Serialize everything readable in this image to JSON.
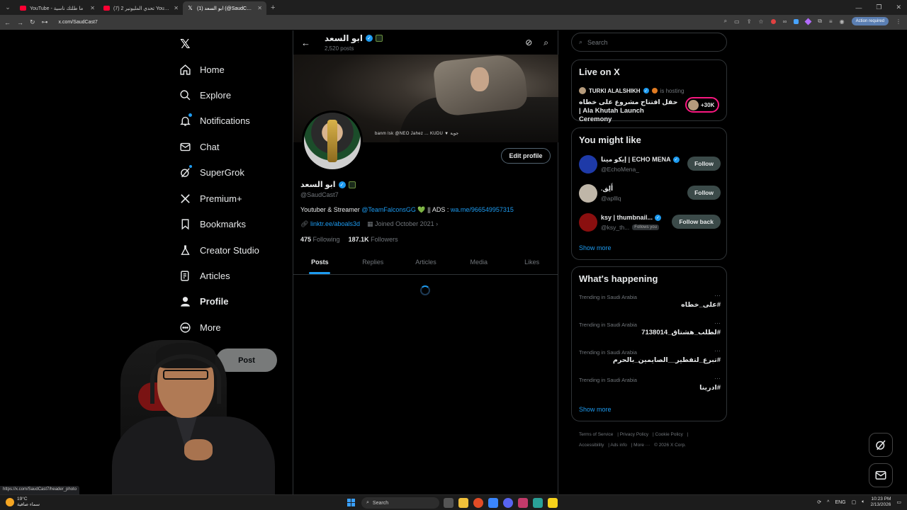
{
  "browser": {
    "tabs": [
      {
        "title": "YouTube - ما طلتك ناسية",
        "icon": "youtube-icon",
        "active": false
      },
      {
        "title": "(7) تحدي المليونير 2 YouTube -",
        "icon": "youtube-icon",
        "active": false
      },
      {
        "title": "(1) ابو السعد (@SaudCast7) / X",
        "icon": "x-icon",
        "active": true
      }
    ],
    "url": "x.com/SaudCast7",
    "action_required": "Action required"
  },
  "nav": {
    "items": [
      {
        "label": "Home",
        "icon": "home-icon"
      },
      {
        "label": "Explore",
        "icon": "search-icon"
      },
      {
        "label": "Notifications",
        "icon": "bell-icon"
      },
      {
        "label": "Chat",
        "icon": "mail-icon"
      },
      {
        "label": "SuperGrok",
        "icon": "grok-icon"
      },
      {
        "label": "Premium+",
        "icon": "x-icon"
      },
      {
        "label": "Bookmarks",
        "icon": "bookmark-icon"
      },
      {
        "label": "Creator Studio",
        "icon": "flask-icon"
      },
      {
        "label": "Articles",
        "icon": "article-icon"
      },
      {
        "label": "Profile",
        "icon": "person-icon"
      },
      {
        "label": "More",
        "icon": "more-icon"
      }
    ],
    "post_label": "Post"
  },
  "profile": {
    "topbar_name": "ابو السعد",
    "post_count": "2,520 posts",
    "banner_caption": "banm lsk @NEO Jahez ... KUDU ▼ جوية",
    "edit_label": "Edit profile",
    "name": "ابو السعد",
    "handle": "@SaudCast7",
    "bio_prefix": "Youtuber & Streamer",
    "bio_mention": "@TeamFalconsGG",
    "bio_heart": "💚",
    "bio_mid": "|| ADS :",
    "bio_link": "wa.me/966549957315",
    "website": "linktr.ee/aboals3d",
    "joined": "Joined October 2021",
    "following_count": "475",
    "following_label": "Following",
    "followers_count": "187.1K",
    "followers_label": "Followers",
    "tabs": [
      "Posts",
      "Replies",
      "Articles",
      "Media",
      "Likes"
    ]
  },
  "right": {
    "search_placeholder": "Search",
    "live": {
      "title": "Live on X",
      "host": "TURKI ALALSHIKH",
      "hosting": "is hosting",
      "event": "حفل افتتاح مشروع على خطاه | Ala Khutah Launch Ceremony",
      "count": "+30K"
    },
    "wtf": {
      "title": "You might like",
      "users": [
        {
          "name": "إيكو مينا | ECHO MENA",
          "handle": "@EchoMena_",
          "button": "Follow",
          "follows_you": "",
          "verified": true
        },
        {
          "name": ".أَلِق",
          "handle": "@aplllq",
          "button": "Follow",
          "follows_you": "",
          "verified": false
        },
        {
          "name": "ksy | thumbnail...",
          "handle": "@ksy_th...",
          "button": "Follow back",
          "follows_you": "Follows you",
          "verified": true
        }
      ],
      "show_more": "Show more"
    },
    "trends": {
      "title": "What's happening",
      "items": [
        {
          "context": "Trending in Saudi Arabia",
          "name": "#على_خطاه"
        },
        {
          "context": "Trending in Saudi Arabia",
          "name": "#لطلب_هشتاق_7138014"
        },
        {
          "context": "Trending in Saudi Arabia",
          "name": "#تبرع_لتفطير__الصايمين_بالحرم"
        },
        {
          "context": "Trending in Saudi Arabia",
          "name": "#ادرينا"
        }
      ],
      "show_more": "Show more"
    },
    "footer": [
      "Terms of Service",
      "Privacy Policy",
      "Cookie Policy",
      "Accessibility",
      "Ads info",
      "More ···",
      "© 2026 X Corp."
    ]
  },
  "status_url": "https://x.com/SaudCast7/header_photo",
  "taskbar": {
    "temp": "19°C",
    "weather_desc": "سماء صافية",
    "search": "Search",
    "lang": "ENG",
    "time": "10:23 PM",
    "date": "2/13/2026"
  },
  "colors": {
    "accent": "#1d9bf0",
    "live_ring": "#f91880",
    "bg": "#000000"
  }
}
